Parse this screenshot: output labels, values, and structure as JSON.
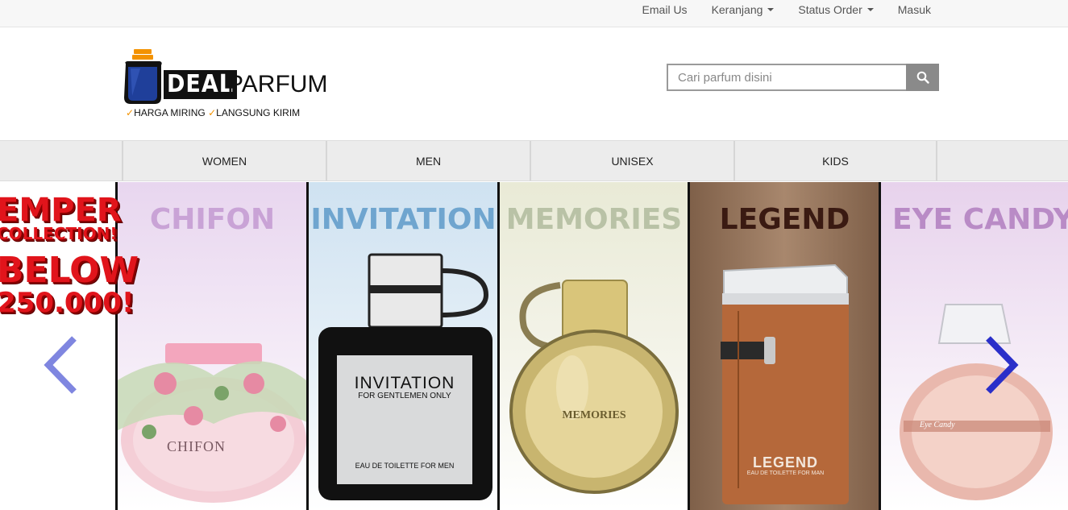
{
  "topbar": {
    "links": [
      {
        "label": "Email Us",
        "dropdown": false
      },
      {
        "label": "Keranjang",
        "dropdown": true
      },
      {
        "label": "Status Order",
        "dropdown": true
      },
      {
        "label": "Masuk",
        "dropdown": false
      }
    ]
  },
  "logo": {
    "deal": "DEAL",
    "parfum": "PARFUM",
    "tag_1": "HARGA MIRING",
    "tag_2": "LANGSUNG KIRIM",
    "colors": {
      "bottle": "#1f3f9a",
      "cap": "#f39200"
    }
  },
  "search": {
    "placeholder": "Cari parfum disini",
    "icon": "search-icon"
  },
  "nav": {
    "items": [
      "WOMEN",
      "MEN",
      "UNISEX",
      "KIDS"
    ]
  },
  "slider": {
    "promo": {
      "line1": "EMPER",
      "line2": "COLLECTION!",
      "line3": "BELOW",
      "line4": "250.000!"
    },
    "panels": [
      {
        "title": "CHIFON",
        "title_color": "#c9a3d6",
        "bg": "#e7d3ee",
        "bottle_label": "CHIFON"
      },
      {
        "title": "INVITATION",
        "title_color": "#6fa5cf",
        "bg": "#d6e7f3",
        "bottle_label": "INVITATION",
        "bottle_sub": "FOR GENTLEMEN ONLY",
        "bottle_foot": "EAU DE TOILETTE FOR MEN"
      },
      {
        "title": "MEMORIES",
        "title_color": "#b9c2a6",
        "bg": "#ededde",
        "bottle_label": "MEMORIES"
      },
      {
        "title": "LEGEND",
        "title_color": "#3a1a12",
        "bg": "#9d7c63",
        "bottle_label": "LEGEND",
        "bottle_sub": "EAU DE TOILETTE FOR MAN"
      },
      {
        "title": "EYE CANDY",
        "title_color": "#b98bc6",
        "bg": "#ecdcef",
        "bottle_label": "Eye Candy"
      }
    ],
    "prev_icon": "chevron-left-icon",
    "next_icon": "chevron-right-icon",
    "colors": {
      "prev": "#7f86e0",
      "next": "#2a2fc9"
    }
  }
}
